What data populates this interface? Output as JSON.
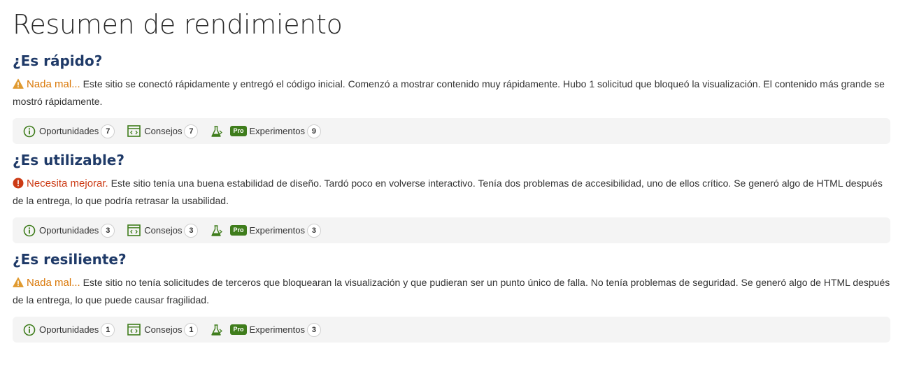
{
  "page": {
    "title": "Resumen de rendimiento"
  },
  "colors": {
    "heading": "#1f3a68",
    "warn": "#d97706",
    "bad": "#cc3a14",
    "pro_badge": "#3f7d1c",
    "icon_green": "#3f7d1c"
  },
  "sections": [
    {
      "question": "¿Es rápido?",
      "verdict_icon": "warning-triangle-icon",
      "verdict": "Nada mal...",
      "summary": "Este sitio se conectó rápidamente y entregó el código inicial. Comenzó a mostrar contenido muy rápidamente. Hubo 1 solicitud que bloqueó la visualización. El contenido más grande se mostró rápidamente.",
      "chips": {
        "opportunities_label": "Oportunidades",
        "opportunities_count": "7",
        "tips_label": "Consejos",
        "tips_count": "7",
        "pro_badge": "Pro",
        "experiments_label": "Experimentos",
        "experiments_count": "9"
      }
    },
    {
      "question": "¿Es utilizable?",
      "verdict_icon": "alert-circle-icon",
      "verdict": "Necesita mejorar.",
      "summary": "Este sitio tenía una buena estabilidad de diseño. Tardó poco en volverse interactivo. Tenía dos problemas de accesibilidad, uno de ellos crítico. Se generó algo de HTML después de la entrega, lo que podría retrasar la usabilidad.",
      "chips": {
        "opportunities_label": "Oportunidades",
        "opportunities_count": "3",
        "tips_label": "Consejos",
        "tips_count": "3",
        "pro_badge": "Pro",
        "experiments_label": "Experimentos",
        "experiments_count": "3"
      }
    },
    {
      "question": "¿Es resiliente?",
      "verdict_icon": "warning-triangle-icon",
      "verdict": "Nada mal...",
      "summary": "Este sitio no tenía solicitudes de terceros que bloquearan la visualización y que pudieran ser un punto único de falla. No tenía problemas de seguridad. Se generó algo de HTML después de la entrega, lo que puede causar fragilidad.",
      "chips": {
        "opportunities_label": "Oportunidades",
        "opportunities_count": "1",
        "tips_label": "Consejos",
        "tips_count": "1",
        "pro_badge": "Pro",
        "experiments_label": "Experimentos",
        "experiments_count": "3"
      }
    }
  ]
}
